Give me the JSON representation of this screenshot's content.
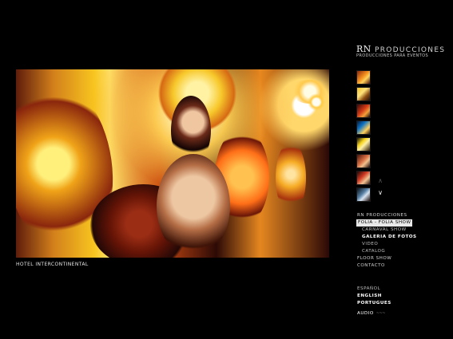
{
  "main": {
    "caption": "HOTEL INTERCONTINENTAL"
  },
  "brand": {
    "logo_mark": "RN",
    "logo_name": "PRODUCCIONES",
    "subtitle": "PRODUCCIONES PARA EVENTOS"
  },
  "thumbnail_nav": {
    "up_arrow": "∧",
    "down_arrow": "∨"
  },
  "menu": {
    "items": [
      {
        "label": "RN PRODUCCIONES"
      },
      {
        "label": "FOLIA - FOLIA SHOW"
      },
      {
        "label": "CARNAVAL SHOW"
      },
      {
        "label": "GALERIA DE FOTOS"
      },
      {
        "label": "VIDEO"
      },
      {
        "label": "CATALOG"
      },
      {
        "label": "FLOOR SHOW"
      },
      {
        "label": "CONTACTO"
      }
    ]
  },
  "languages": [
    {
      "label": "ESPAÑOL"
    },
    {
      "label": "ENGLISH"
    },
    {
      "label": "PORTUGUES"
    }
  ],
  "audio": {
    "label": "AUDIO",
    "wave": "~~~"
  }
}
